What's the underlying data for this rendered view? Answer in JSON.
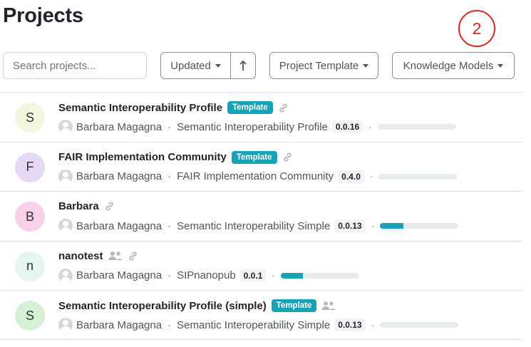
{
  "page": {
    "title": "Projects"
  },
  "annotation": {
    "label": "2"
  },
  "toolbar": {
    "search_placeholder": "Search projects...",
    "sort_label": "Updated",
    "sort_direction_icon": "arrow-up-icon",
    "template_filter_label": "Project Template",
    "km_filter_label": "Knowledge Models"
  },
  "colors": {
    "accent": "#17a2b8",
    "annotation": "#d9261c"
  },
  "projects": [
    {
      "initial": "S",
      "avatar_color": "#f2f7dd",
      "name": "Semantic Interoperability Profile",
      "badge": "Template",
      "shared": false,
      "linked": true,
      "owner": "Barbara Magagna",
      "knowledge_model": "Semantic Interoperability Profile",
      "version": "0.0.16",
      "progress": 0
    },
    {
      "initial": "F",
      "avatar_color": "#e5d9f6",
      "name": "FAIR Implementation Community",
      "badge": "Template",
      "shared": false,
      "linked": true,
      "owner": "Barbara Magagna",
      "knowledge_model": "FAIR Implementation Community",
      "version": "0.4.0",
      "progress": 0
    },
    {
      "initial": "B",
      "avatar_color": "#f7d1e8",
      "name": "Barbara",
      "badge": "",
      "shared": false,
      "linked": true,
      "owner": "Barbara Magagna",
      "knowledge_model": "Semantic Interoperability Simple",
      "version": "0.0.13",
      "progress": 0.3
    },
    {
      "initial": "n",
      "avatar_color": "#e6f6ee",
      "name": "nanotest",
      "badge": "",
      "shared": true,
      "linked": true,
      "owner": "Barbara Magagna",
      "knowledge_model": "SIPnanopub",
      "version": "0.0.1",
      "progress": 0.28
    },
    {
      "initial": "S",
      "avatar_color": "#d6f0d6",
      "name": "Semantic Interoperability Profile (simple)",
      "badge": "Template",
      "shared": true,
      "linked": false,
      "owner": "Barbara Magagna",
      "knowledge_model": "Semantic Interoperability Simple",
      "version": "0.0.13",
      "progress": 0
    }
  ]
}
